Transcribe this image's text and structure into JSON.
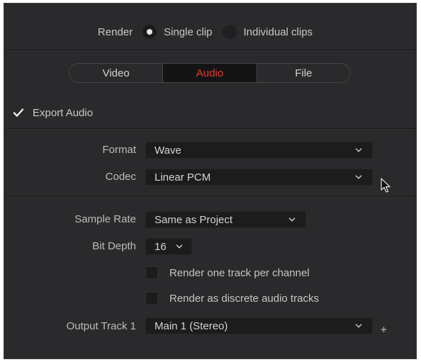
{
  "render": {
    "label": "Render",
    "options": [
      {
        "label": "Single clip",
        "selected": true
      },
      {
        "label": "Individual clips",
        "selected": false
      }
    ]
  },
  "tabs": [
    {
      "label": "Video",
      "active": false
    },
    {
      "label": "Audio",
      "active": true
    },
    {
      "label": "File",
      "active": false
    }
  ],
  "export_audio": {
    "label": "Export Audio",
    "checked": true
  },
  "fields": {
    "format": {
      "label": "Format",
      "value": "Wave"
    },
    "codec": {
      "label": "Codec",
      "value": "Linear PCM"
    },
    "sample_rate": {
      "label": "Sample Rate",
      "value": "Same as Project"
    },
    "bit_depth": {
      "label": "Bit Depth",
      "value": "16"
    },
    "output_track": {
      "label": "Output Track 1",
      "value": "Main 1 (Stereo)"
    }
  },
  "options": {
    "one_track_per_channel": {
      "label": "Render one track per channel",
      "checked": false
    },
    "discrete_tracks": {
      "label": "Render as discrete audio tracks",
      "checked": false
    }
  },
  "add_track": {
    "label": "+"
  },
  "colors": {
    "panel_bg": "#2a2a2c",
    "active_tab_text": "#e33b2e",
    "active_tab_bg": "#141415",
    "field_bg": "#1c1c1d"
  }
}
